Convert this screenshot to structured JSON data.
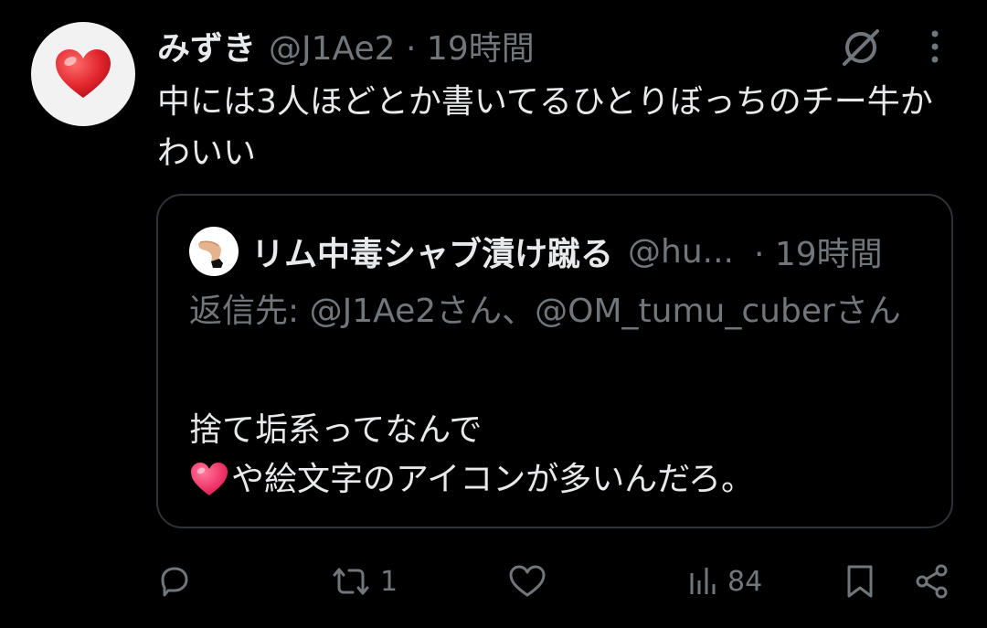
{
  "tweet": {
    "author_name": "みずき",
    "handle_time": "@J1Ae2 · 19時間",
    "text": "中には3人ほどとか書いてるひとりぼっちのチー牛かわいい",
    "avatar_icon": "heart-icon"
  },
  "quote": {
    "author_name": "リム中毒シャブ漬け蹴る",
    "handle": "@hu...",
    "time": "· 19時間",
    "reply_to": "返信先: @J1Ae2さん、@OM_tumu_cuberさん",
    "text_line1": "捨て垢系ってなんで",
    "text_line2": "や絵文字のアイコンが多いんだろ。"
  },
  "actions": {
    "reply": {
      "icon": "reply-icon",
      "count": ""
    },
    "retweet": {
      "icon": "retweet-icon",
      "count": "1"
    },
    "like": {
      "icon": "like-icon",
      "count": ""
    },
    "views": {
      "icon": "views-icon",
      "count": "84"
    },
    "bookmark": {
      "icon": "bookmark-icon"
    },
    "share": {
      "icon": "share-icon"
    }
  },
  "colors": {
    "background": "#000000",
    "primary_text": "#e7e9ea",
    "secondary_text": "#71767b",
    "border": "#2f3336",
    "heart_red": "#e0242b",
    "heart_pink": "#f0356a"
  }
}
